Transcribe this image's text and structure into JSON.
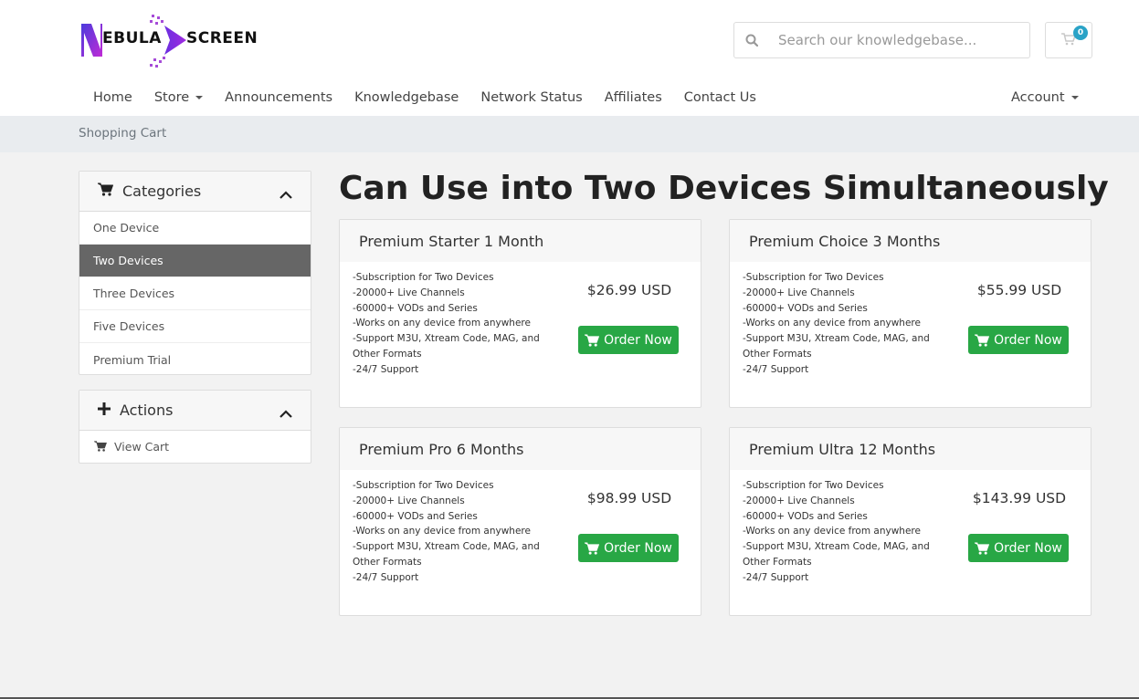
{
  "brand": {
    "left": "EBULA",
    "right": "SCREEN"
  },
  "search": {
    "placeholder": "Search our knowledgebase..."
  },
  "cart": {
    "count": "0"
  },
  "nav": {
    "items": [
      {
        "label": "Home",
        "dropdown": false
      },
      {
        "label": "Store",
        "dropdown": true
      },
      {
        "label": "Announcements",
        "dropdown": false
      },
      {
        "label": "Knowledgebase",
        "dropdown": false
      },
      {
        "label": "Network Status",
        "dropdown": false
      },
      {
        "label": "Affiliates",
        "dropdown": false
      },
      {
        "label": "Contact Us",
        "dropdown": false
      }
    ],
    "account": "Account"
  },
  "breadcrumb": "Shopping Cart",
  "sidebar": {
    "categories": {
      "title": "Categories",
      "items": [
        "One Device",
        "Two Devices",
        "Three Devices",
        "Five Devices",
        "Premium Trial"
      ],
      "active_index": 1
    },
    "actions": {
      "title": "Actions",
      "items": [
        "View Cart"
      ]
    }
  },
  "main": {
    "heading": "Can Use into Two Devices Simultaneously",
    "order_label": "Order Now",
    "products": [
      {
        "name": "Premium Starter 1 Month",
        "price": "$26.99 USD",
        "features": [
          "-Subscription for Two Devices",
          "-20000+ Live Channels",
          "-60000+ VODs and Series",
          "-Works on any device from anywhere",
          "-Support M3U, Xtream Code, MAG, and Other Formats",
          "-24/7 Support"
        ]
      },
      {
        "name": "Premium Choice 3 Months",
        "price": "$55.99 USD",
        "features": [
          "-Subscription for Two Devices",
          "-20000+ Live Channels",
          "-60000+ VODs and Series",
          "-Works on any device from anywhere",
          "-Support M3U, Xtream Code, MAG, and Other Formats",
          "-24/7 Support"
        ]
      },
      {
        "name": "Premium Pro 6 Months",
        "price": "$98.99 USD",
        "features": [
          "-Subscription for Two Devices",
          "-20000+ Live Channels",
          "-60000+ VODs and Series",
          "-Works on any device from anywhere",
          "-Support M3U, Xtream Code, MAG, and Other Formats",
          "-24/7 Support"
        ]
      },
      {
        "name": "Premium Ultra 12 Months",
        "price": "$143.99 USD",
        "features": [
          "-Subscription for Two Devices",
          "-20000+ Live Channels",
          "-60000+ VODs and Series",
          "-Works on any device from anywhere",
          "-Support M3U, Xtream Code, MAG, and Other Formats",
          "-24/7 Support"
        ]
      }
    ]
  },
  "colors": {
    "accent": "#28a745",
    "badge": "#2aa3c7",
    "active": "#666666",
    "logo_purple": "#8a2be2"
  }
}
